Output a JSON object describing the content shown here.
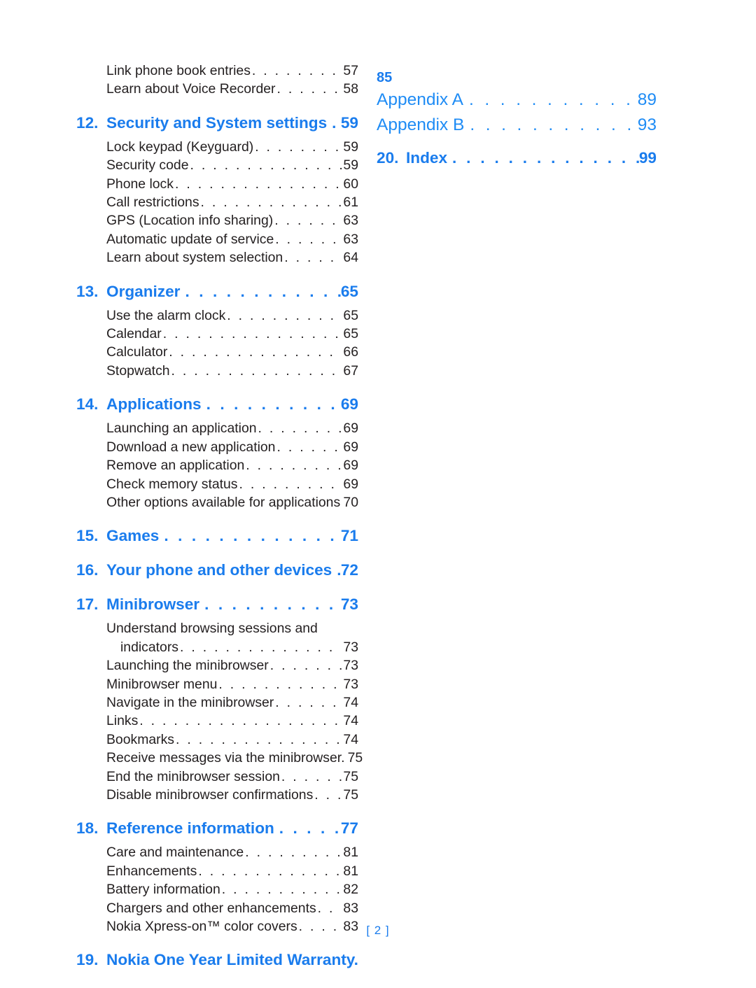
{
  "document": {
    "type": "table-of-contents",
    "folio": "[ 2 ]",
    "accent_color": "#1a7ced",
    "body_color": "#231f20",
    "background": "#ffffff"
  },
  "left_column": {
    "orphan_entries": [
      {
        "label": "Link phone book entries",
        "page": "57"
      },
      {
        "label": "Learn about Voice Recorder",
        "page": "58"
      }
    ],
    "sections": [
      {
        "num": "12.",
        "title": "Security and System settings",
        "page": "59",
        "entries": [
          {
            "label": "Lock keypad (Keyguard)",
            "page": "59"
          },
          {
            "label": "Security code",
            "page": "59"
          },
          {
            "label": "Phone lock",
            "page": "60"
          },
          {
            "label": "Call restrictions",
            "page": "61"
          },
          {
            "label": "GPS (Location info sharing)",
            "page": "63"
          },
          {
            "label": "Automatic update of service",
            "page": "63"
          },
          {
            "label": "Learn about system selection",
            "page": "64"
          }
        ]
      },
      {
        "num": "13.",
        "title": "Organizer",
        "page": "65",
        "entries": [
          {
            "label": "Use the alarm clock",
            "page": "65"
          },
          {
            "label": "Calendar",
            "page": "65"
          },
          {
            "label": "Calculator",
            "page": "66"
          },
          {
            "label": "Stopwatch",
            "page": "67"
          }
        ]
      },
      {
        "num": "14.",
        "title": "Applications",
        "page": "69",
        "entries": [
          {
            "label": "Launching an application",
            "page": "69"
          },
          {
            "label": "Download a new application",
            "page": "69"
          },
          {
            "label": "Remove an application",
            "page": "69"
          },
          {
            "label": "Check memory status",
            "page": "69"
          },
          {
            "label": "Other options available for applications",
            "page": "70",
            "no_dots": true
          }
        ]
      },
      {
        "num": "15.",
        "title": "Games",
        "page": "71",
        "entries": []
      },
      {
        "num": "16.",
        "title": "Your phone and other devices",
        "page": "72",
        "entries": []
      },
      {
        "num": "17.",
        "title": "Minibrowser",
        "page": "73",
        "entries": [
          {
            "label": "Understand browsing sessions and",
            "page": "",
            "no_dots": true
          },
          {
            "label": "indicators",
            "page": "73",
            "deep": true
          },
          {
            "label": "Launching the minibrowser",
            "page": "73"
          },
          {
            "label": "Minibrowser menu",
            "page": "73"
          },
          {
            "label": "Navigate in the minibrowser",
            "page": "74"
          },
          {
            "label": "Links",
            "page": "74"
          },
          {
            "label": "Bookmarks",
            "page": "74"
          },
          {
            "label": "Receive messages via the minibrowser.",
            "page": "75",
            "no_dots": true
          },
          {
            "label": "End the minibrowser session",
            "page": "75"
          },
          {
            "label": "Disable minibrowser confirmations",
            "page": "75"
          }
        ]
      },
      {
        "num": "18.",
        "title": "Reference information",
        "page": "77",
        "entries": [
          {
            "label": "Care and maintenance",
            "page": "81"
          },
          {
            "label": "Enhancements",
            "page": "81"
          },
          {
            "label": "Battery information",
            "page": "82"
          },
          {
            "label": "Chargers and other enhancements",
            "page": "83"
          },
          {
            "label": "Nokia Xpress-on™ color covers",
            "page": "83",
            "trademark": true
          }
        ]
      },
      {
        "num": "19.",
        "title": "Nokia One Year Limited Warranty.",
        "page": "",
        "entries": [],
        "no_leader": true
      }
    ]
  },
  "right_column": {
    "continued_page": "85",
    "appendices": [
      {
        "label": "Appendix A",
        "page": "89"
      },
      {
        "label": "Appendix B",
        "page": "93"
      }
    ],
    "index": {
      "num": "20.",
      "label": "Index",
      "page": "99"
    }
  },
  "leader_dots": ". . . . . . . . . . . . . . . . . . . . . . . . . . . . . . . . . . . . . . . . . . . . . . . . . . . . . . . . . . . ."
}
